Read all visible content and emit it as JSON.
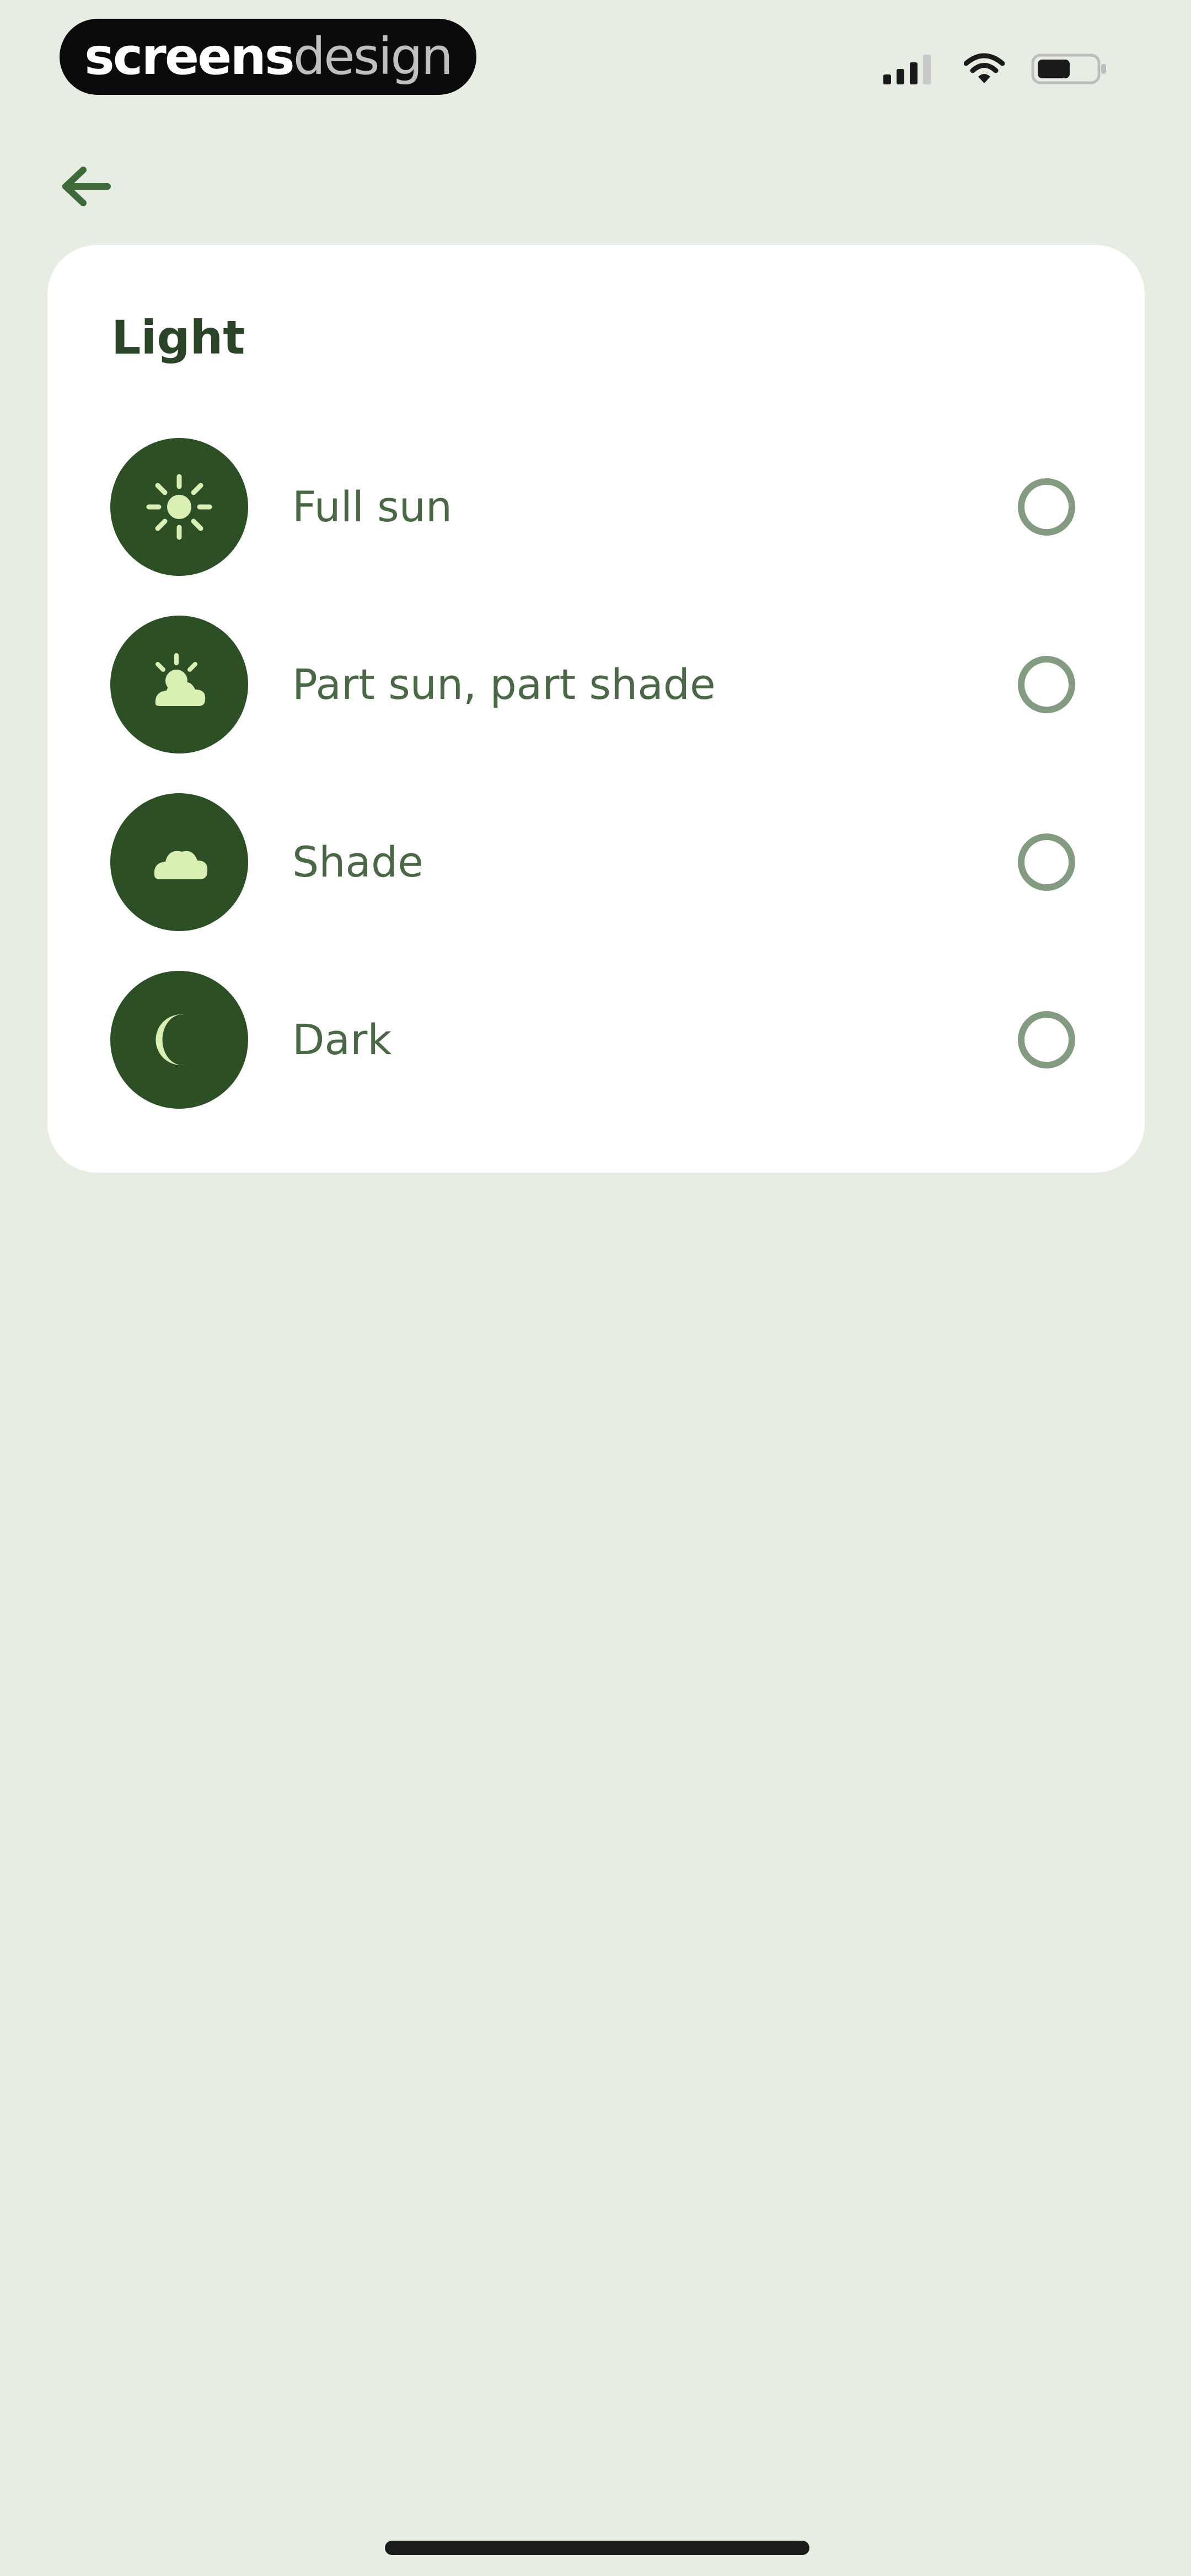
{
  "status_bar": {
    "logo_bold": "screens",
    "logo_light": "design",
    "icons": [
      "signal-icon",
      "wifi-icon",
      "battery-icon"
    ]
  },
  "nav": {
    "back_icon": "arrow-left-icon"
  },
  "light_card": {
    "title": "Light",
    "options": [
      {
        "label": "Full sun",
        "icon": "sun-icon",
        "selected": false
      },
      {
        "label": "Part sun, part shade",
        "icon": "sun-cloud-icon",
        "selected": false
      },
      {
        "label": "Shade",
        "icon": "cloud-icon",
        "selected": false
      },
      {
        "label": "Dark",
        "icon": "moon-icon",
        "selected": false
      }
    ]
  },
  "colors": {
    "background": "#e8ede4",
    "card": "#ffffff",
    "accent_dark_green": "#2c4f26",
    "icon_fill": "#d9efb3",
    "label_text": "#4a6746",
    "radio_border": "#839b80"
  }
}
